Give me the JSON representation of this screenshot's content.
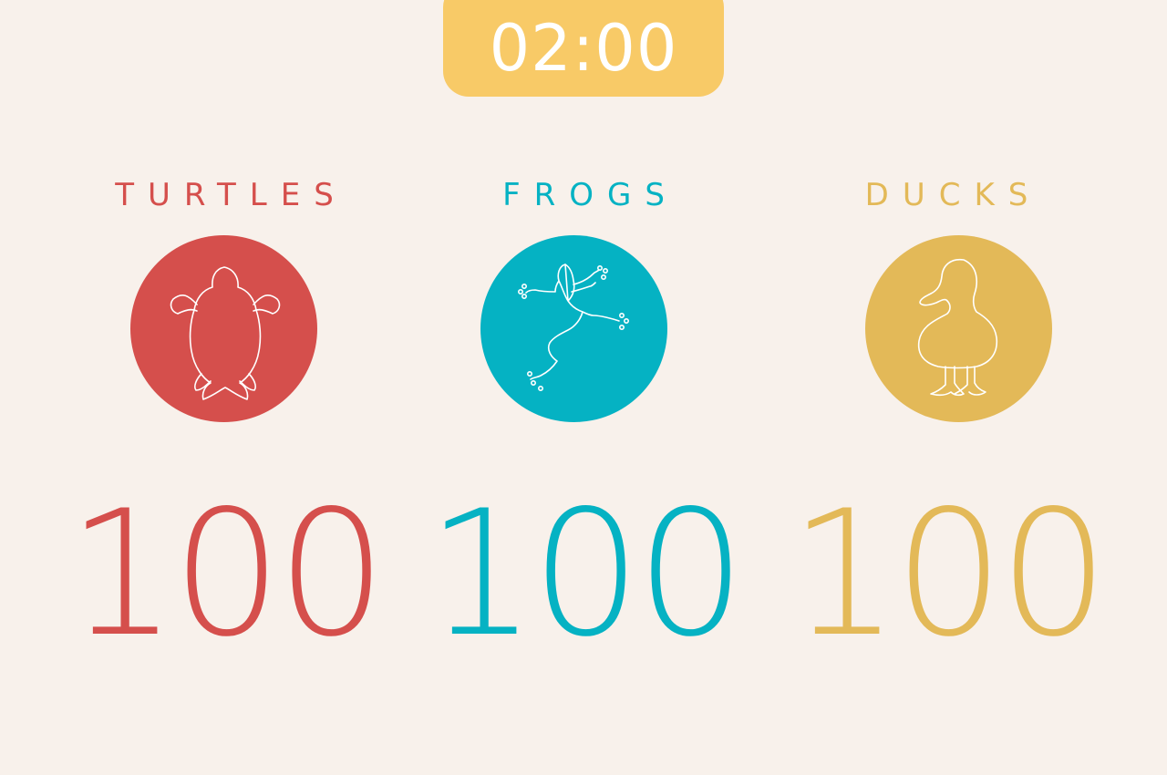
{
  "timer": {
    "value": "02:00"
  },
  "colors": {
    "background": "#f8f1eb",
    "timer": "#f8ca67"
  },
  "teams": [
    {
      "name": "TURTLES",
      "icon": "turtle-icon",
      "color": "#d54f4c",
      "score": "100"
    },
    {
      "name": "FROGS",
      "icon": "frog-icon",
      "color": "#05b2c3",
      "score": "100"
    },
    {
      "name": "DUCKS",
      "icon": "duck-icon",
      "color": "#e3b958",
      "score": "100"
    }
  ]
}
